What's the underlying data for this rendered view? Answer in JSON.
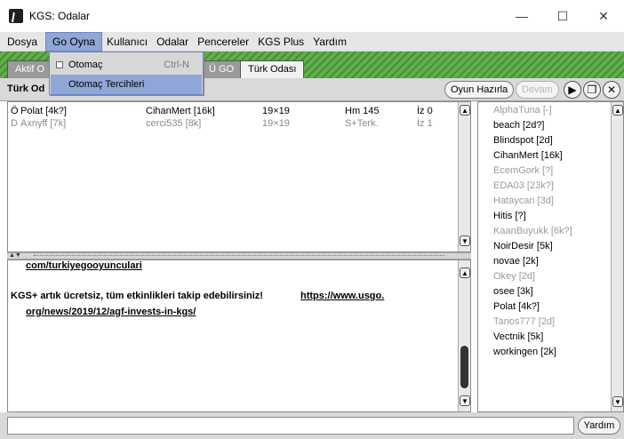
{
  "window": {
    "title": "KGS: Odalar",
    "buttons": [
      "—",
      "☐",
      "✕"
    ]
  },
  "menubar": {
    "items": [
      "Dosya",
      "Go Oyna",
      "Kullanıcı",
      "Odalar",
      "Pencereler",
      "KGS Plus",
      "Yardım"
    ]
  },
  "dropdown": {
    "item1": {
      "label": "Otomaç",
      "shortcut": "Ctrl-N"
    },
    "item2": {
      "label": "Otomaç Tercihleri"
    }
  },
  "tabs": {
    "tab1": "Aktif O",
    "tab2": "Ü GO",
    "tab3": "Türk Odası"
  },
  "room": {
    "name": "Türk Od",
    "buttons": {
      "hazirla": "Oyun Hazırla",
      "devam": "Devam"
    }
  },
  "games": [
    {
      "type": "Ö",
      "white": "Polat [4k?]",
      "black": "CihanMert [16k]",
      "size": "19×19",
      "status": "Hm 145",
      "obs": "İz 0",
      "dim": false
    },
    {
      "type": "D",
      "white": "Axnyff [7k]",
      "black": "cerci535 [8k]",
      "size": "19×19",
      "status": "S+Terk.",
      "obs": "İz 1",
      "dim": true
    }
  ],
  "chat": {
    "partial_link": "com/turkiyegooyunculari",
    "message": "KGS+ artık ücretsiz, tüm etkinlikleri takip edebilirsiniz!",
    "link1": "https://www.usgo.",
    "link2": "org/news/2019/12/agf-invests-in-kgs/"
  },
  "users": [
    {
      "name": "AlphaTuna [-]",
      "dim": true
    },
    {
      "name": "beach [2d?]",
      "dim": false
    },
    {
      "name": "Blindspot [2d]",
      "dim": false
    },
    {
      "name": "CihanMert [16k]",
      "dim": false
    },
    {
      "name": "EcemGork [?]",
      "dim": true
    },
    {
      "name": "EDA03 [23k?]",
      "dim": true
    },
    {
      "name": "Hataycan [3d]",
      "dim": true
    },
    {
      "name": "Hitis [?]",
      "dim": false
    },
    {
      "name": "KaanBuyukk [6k?]",
      "dim": true
    },
    {
      "name": "NoirDesir [5k]",
      "dim": false
    },
    {
      "name": "novae [2k]",
      "dim": false
    },
    {
      "name": "Okey [2d]",
      "dim": true
    },
    {
      "name": "osee [3k]",
      "dim": false
    },
    {
      "name": "Polat [4k?]",
      "dim": false
    },
    {
      "name": "Tanos777 [2d]",
      "dim": true
    },
    {
      "name": "Vectnik [5k]",
      "dim": false
    },
    {
      "name": "workingen [2k]",
      "dim": false
    }
  ],
  "bottom": {
    "input_value": "",
    "help": "Yardım"
  }
}
